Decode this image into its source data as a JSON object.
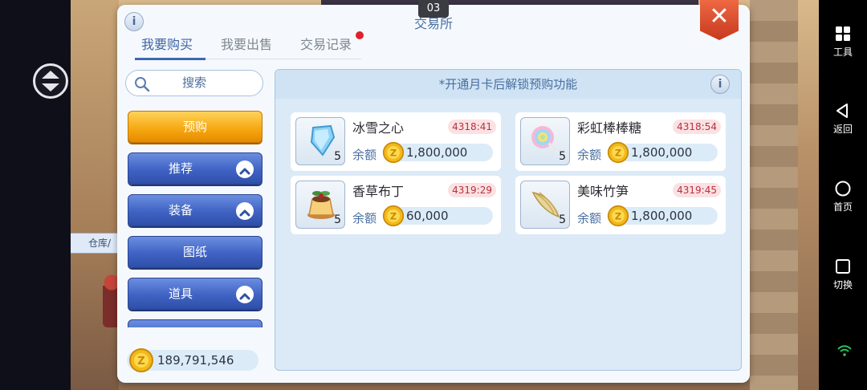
{
  "clock": "03",
  "window": {
    "title": "交易所",
    "close_label": "✕",
    "info_label": "i"
  },
  "tabs": [
    {
      "label": "我要购买",
      "active": true
    },
    {
      "label": "我要出售",
      "active": false
    },
    {
      "label": "交易记录",
      "active": false,
      "has_notification": true
    }
  ],
  "search": {
    "label": "搜索"
  },
  "categories": [
    {
      "label": "预购",
      "style": "gold"
    },
    {
      "label": "推荐",
      "expandable": true
    },
    {
      "label": "装备",
      "expandable": true
    },
    {
      "label": "图纸",
      "expandable": false
    },
    {
      "label": "道具",
      "expandable": true
    }
  ],
  "balance": {
    "value": "189,791,546"
  },
  "notice": "*开通月卡后解锁预购功能",
  "items": [
    {
      "name": "冰雪之心",
      "time": "4318:41",
      "qty": "5",
      "amount_label": "余额",
      "amount": "1,800,000",
      "icon": "ice-crystal-icon"
    },
    {
      "name": "彩虹棒棒糖",
      "time": "4318:54",
      "qty": "5",
      "amount_label": "余额",
      "amount": "1,800,000",
      "icon": "rainbow-lollipop-icon"
    },
    {
      "name": "香草布丁",
      "time": "4319:29",
      "qty": "5",
      "amount_label": "余额",
      "amount": "60,000",
      "icon": "vanilla-pudding-icon"
    },
    {
      "name": "美味竹笋",
      "time": "4319:45",
      "qty": "5",
      "amount_label": "余额",
      "amount": "1,800,000",
      "icon": "bamboo-shoot-icon"
    }
  ],
  "background": {
    "sign_text": "仓库/"
  },
  "navbar": {
    "tools": "工具",
    "back": "返回",
    "home": "首页",
    "switch": "切换"
  },
  "colors": {
    "accent_blue": "#3e63a3",
    "gold_button": "#f5a60f",
    "close_red": "#d9472a",
    "timer_red": "#b8323c",
    "notification_dot": "#e0202a"
  }
}
